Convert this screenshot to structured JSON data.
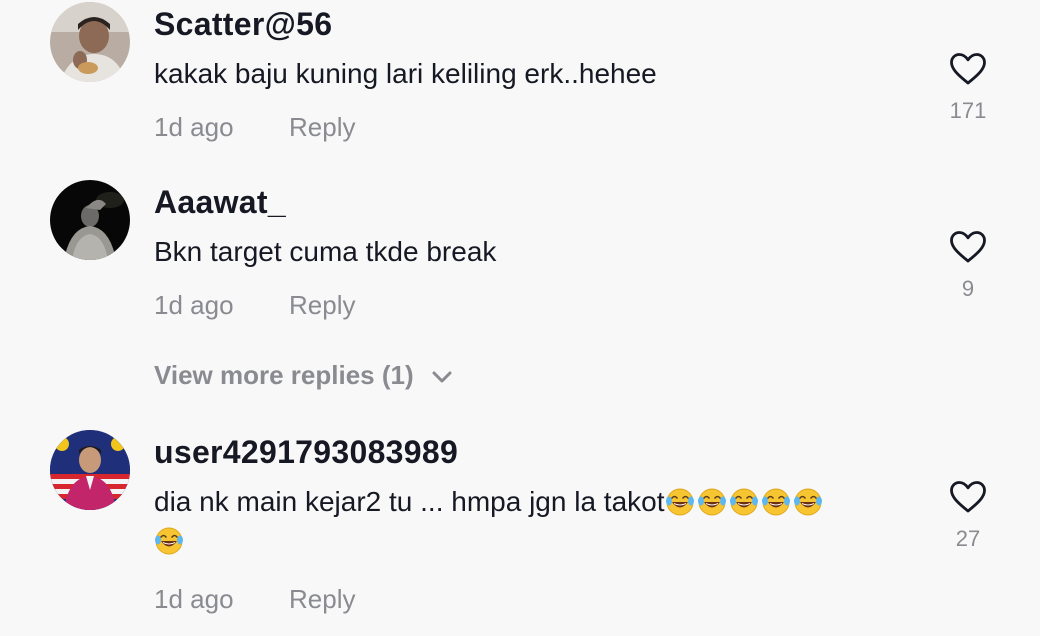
{
  "comments": [
    {
      "username": "Scatter@56",
      "text": "kakak baju kuning lari keliling erk..hehee",
      "time": "1d ago",
      "reply_label": "Reply",
      "likes": "171"
    },
    {
      "username": "Aaawat_",
      "text": "Bkn target cuma tkde break",
      "time": "1d ago",
      "reply_label": "Reply",
      "likes": "9",
      "view_more": "View more replies (1)"
    },
    {
      "username": "user4291793083989",
      "text": "dia nk main kejar2 tu ... hmpa jgn la takot",
      "emoji": "face-with-tears-of-joy",
      "emoji_count_inline": 5,
      "emoji_count_wrapped": 1,
      "time": "1d ago",
      "reply_label": "Reply",
      "likes": "27"
    }
  ],
  "icons": {
    "like": "heart-outline-icon",
    "expand": "chevron-down-icon"
  },
  "colors": {
    "background": "#f8f8f8",
    "primary_text": "#161823",
    "secondary_text": "#8a8b91"
  }
}
